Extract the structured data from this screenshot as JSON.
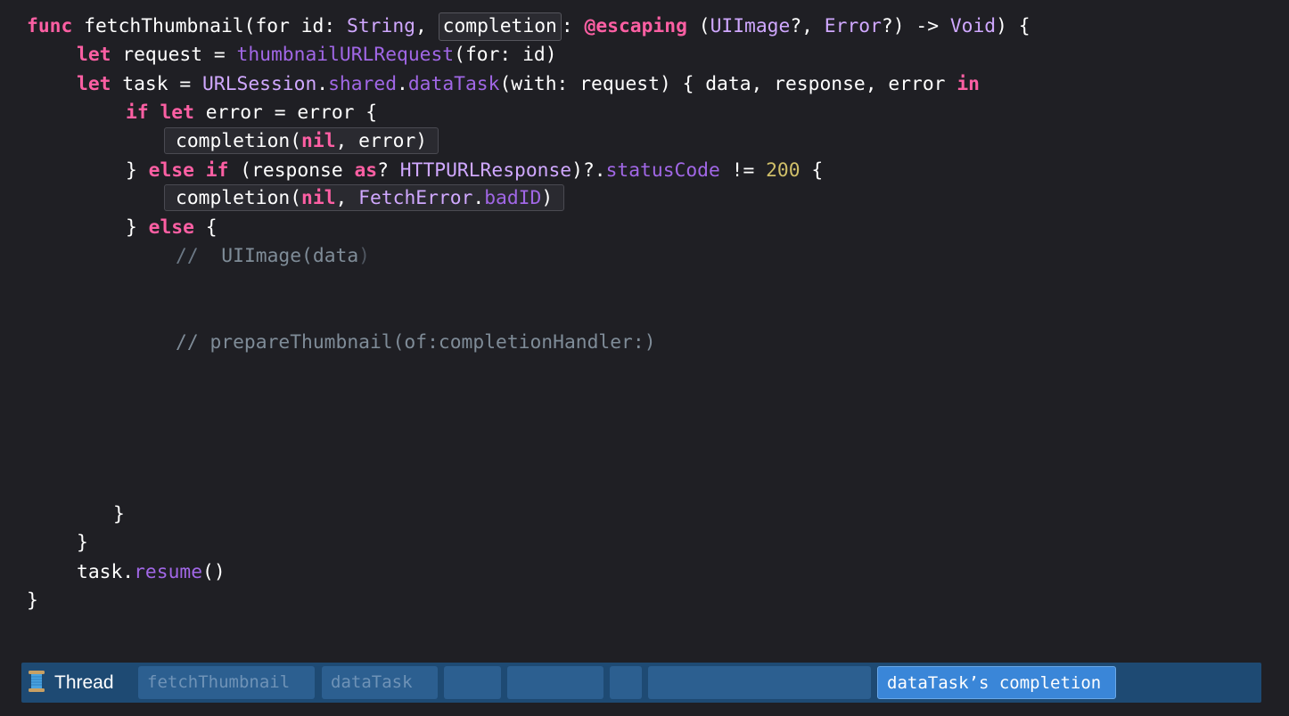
{
  "code": {
    "l1": {
      "func": "func",
      "name": " fetchThumbnail(for id: ",
      "string": "String",
      "sep": ", ",
      "completion": "completion",
      "colon": ": ",
      "escaping": "@escaping",
      "open": " (",
      "uiimage": "UIImage",
      "q1": "?, ",
      "error": "Error",
      "tail": "?) -> ",
      "void": "Void",
      "brace": ") {"
    },
    "l2": {
      "let": "let",
      "mid": " request = ",
      "fn": "thumbnailURLRequest",
      "tail": "(for: id)"
    },
    "l3": {
      "let": "let",
      "mid": " task = ",
      "urlsession": "URLSession",
      "dot1": ".",
      "shared": "shared",
      "dot2": ".",
      "datatask": "dataTask",
      "tail": "(with: request) { data, response, error ",
      "in": "in"
    },
    "l4": {
      "if": "if",
      "let": "let",
      "tail": " error = error {"
    },
    "l5": {
      "pre": "completion(",
      "nil": "nil",
      "tail": ", error)"
    },
    "l6": {
      "close": "} ",
      "else": "else",
      "if": "if",
      "open": " (response ",
      "as": "as",
      "q": "? ",
      "http": "HTTPURLResponse",
      "mid": ")?.",
      "status": "statusCode",
      "neq": " != ",
      "num": "200",
      "brace": " {"
    },
    "l7": {
      "pre": "completion(",
      "nil": "nil",
      "sep": ", ",
      "fetcherror": "FetchError",
      "dot": ".",
      "badid": "badID",
      "tail": ")"
    },
    "l8": {
      "close": "} ",
      "else": "else",
      "brace": " {"
    },
    "l9": {
      "slashes": "//",
      "text": "  UIImage(data",
      "paren": ")"
    },
    "l10": {
      "text": "// prepareThumbnail(of:completionHandler:)"
    },
    "l11": "}",
    "l12": "}",
    "l13": {
      "task": "task.",
      "resume": "resume",
      "parens": "()"
    },
    "l14": "}"
  },
  "thread_bar": {
    "label": "Thread",
    "segments": [
      {
        "label": "fetchThumbnail"
      },
      {
        "label": "dataTask"
      },
      {
        "label": ""
      },
      {
        "label": ""
      },
      {
        "label": ""
      },
      {
        "label": ""
      },
      {
        "label": "dataTask’s completion",
        "active": true
      }
    ]
  },
  "colors": {
    "background": "#1f1f24",
    "keyword": "#fc5fa3",
    "type": "#d0a8ff",
    "function": "#a167e6",
    "number": "#d0bf69",
    "comment": "#6c7986",
    "thread_bar": "#1e4a73",
    "active_segment": "#3a86d8"
  }
}
